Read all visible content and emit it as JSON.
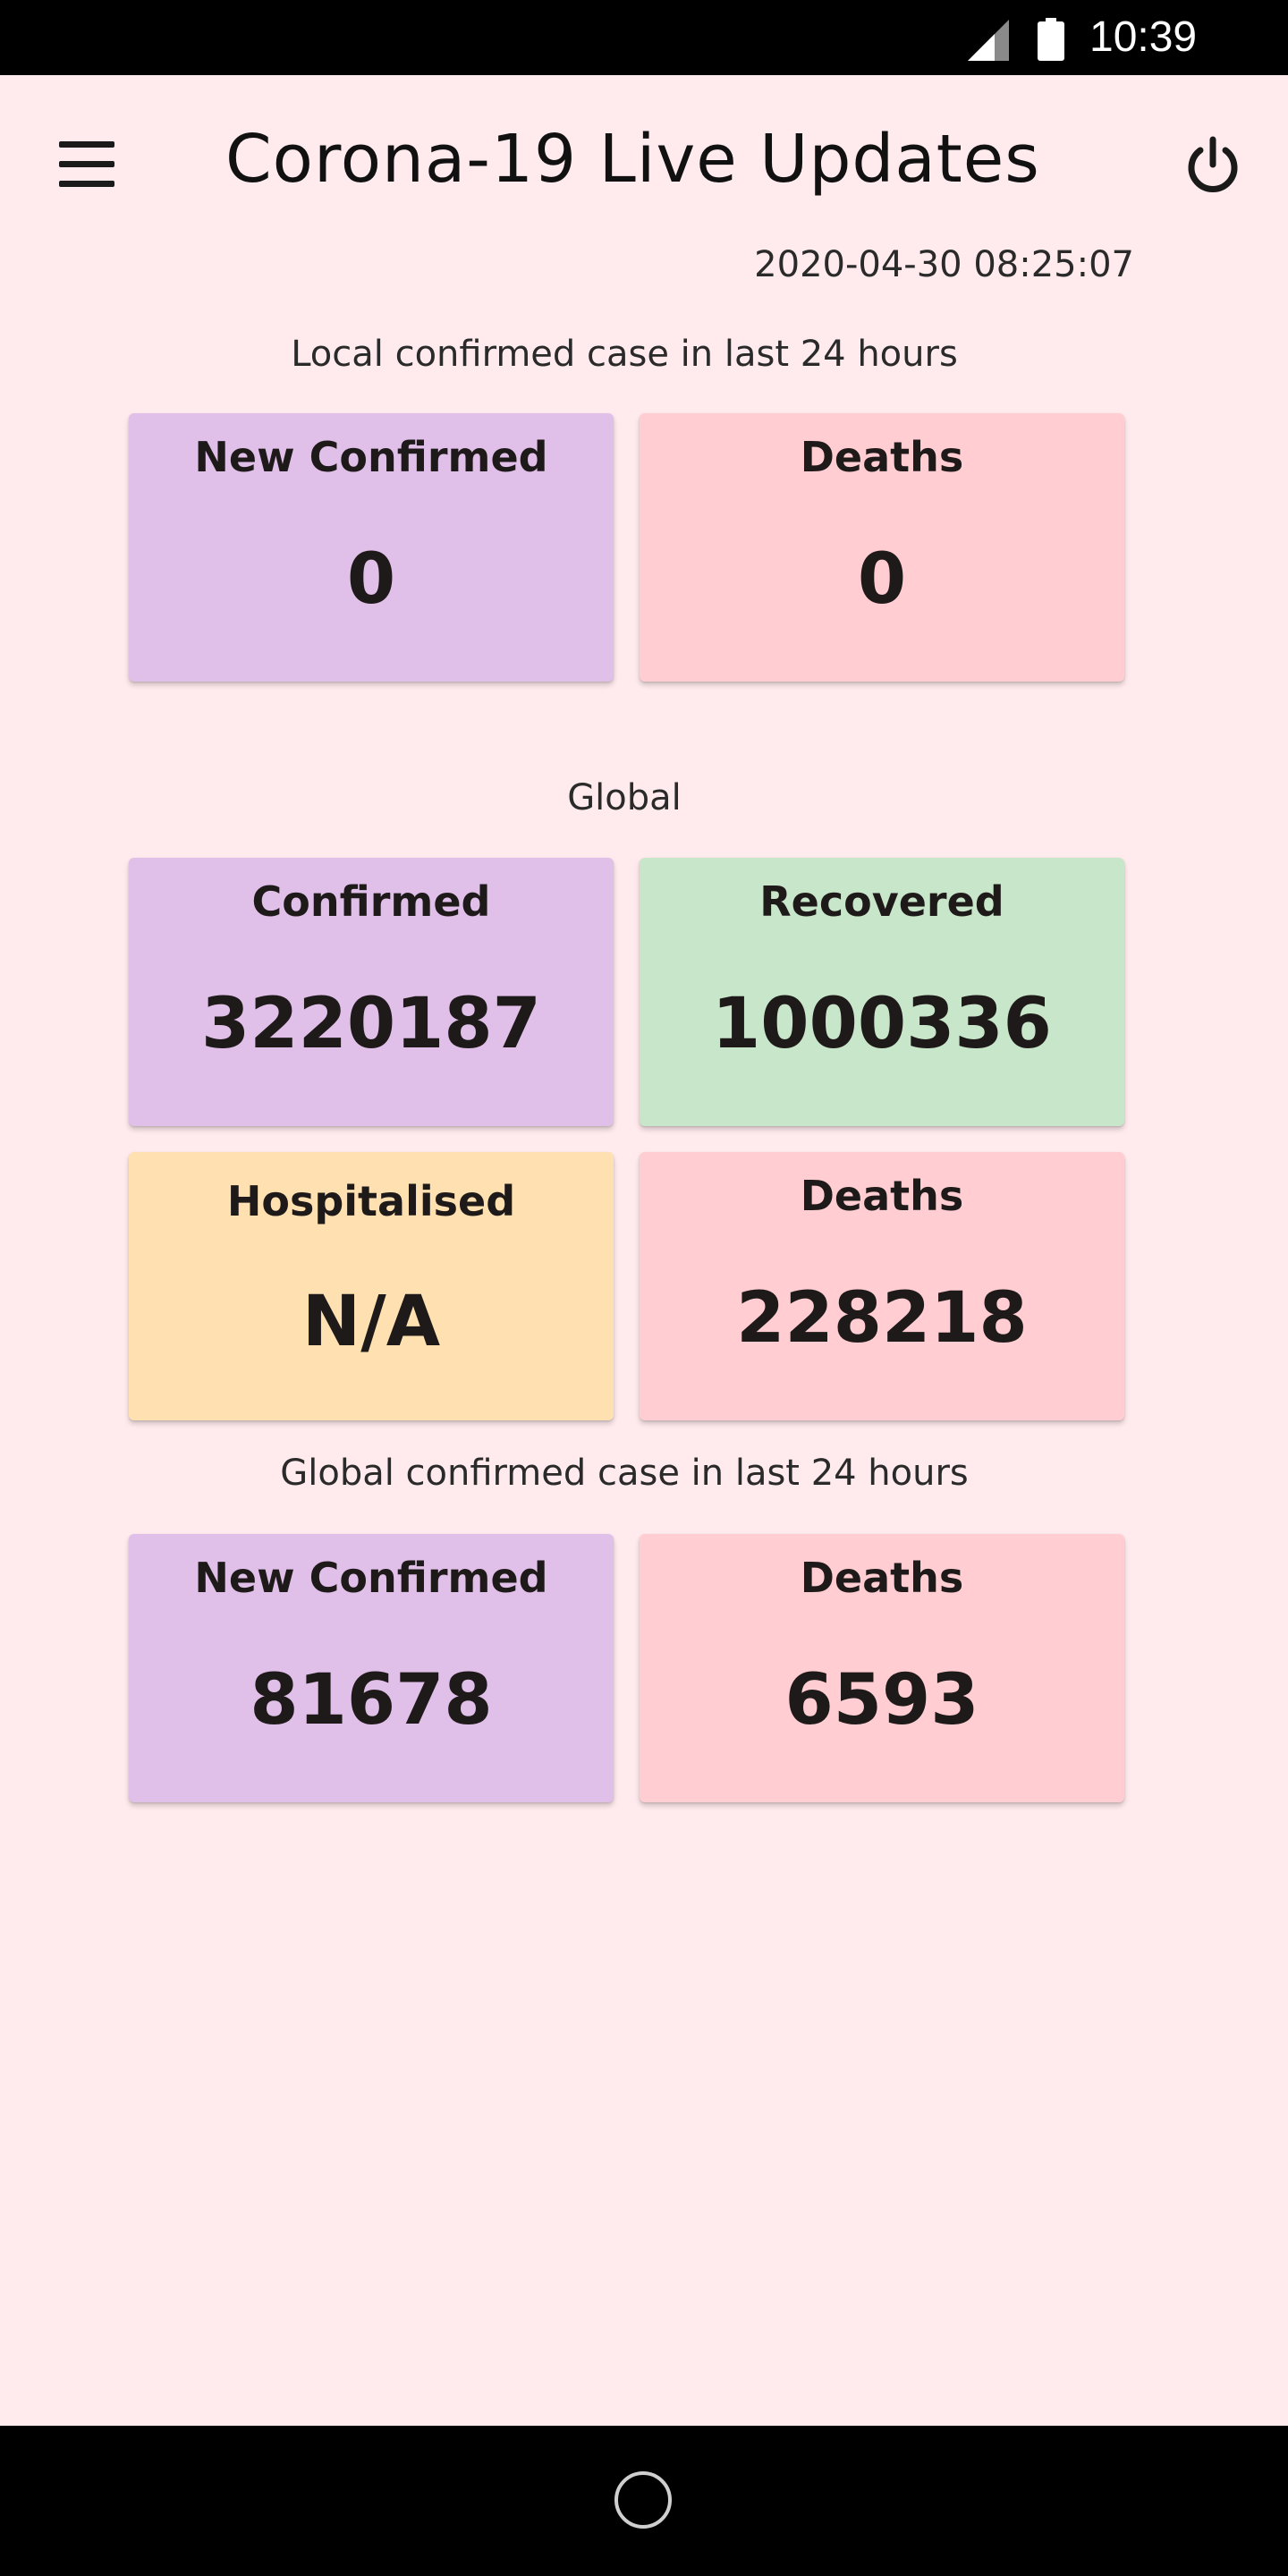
{
  "status_bar": {
    "time": "10:39",
    "icons": [
      "signal-icon",
      "battery-icon"
    ]
  },
  "app_bar": {
    "title": "Corona-19 Live Updates",
    "menu_icon": "hamburger-menu-icon",
    "power_icon": "power-icon"
  },
  "timestamp": "2020-04-30 08:25:07",
  "local_section": {
    "label": "Local confirmed case in last 24 hours",
    "cards": [
      {
        "label": "New Confirmed",
        "value": "0",
        "color": "#e0bfe8"
      },
      {
        "label": "Deaths",
        "value": "0",
        "color": "#ffcdd2"
      }
    ]
  },
  "global_section": {
    "label": "Global",
    "cards": [
      {
        "label": "Confirmed",
        "value": "3220187",
        "color": "#e0bfe8"
      },
      {
        "label": "Recovered",
        "value": "1000336",
        "color": "#c8e6c9"
      },
      {
        "label": "Hospitalised",
        "value": "N/A",
        "color": "#ffe1b1"
      },
      {
        "label": "Deaths",
        "value": "228218",
        "color": "#ffcdd2"
      }
    ]
  },
  "global_24h_section": {
    "label": "Global confirmed case in last 24 hours",
    "cards": [
      {
        "label": "New Confirmed",
        "value": "81678",
        "color": "#e0bfe8"
      },
      {
        "label": "Deaths",
        "value": "6593",
        "color": "#ffcdd2"
      }
    ]
  },
  "nav_bar": {
    "home_icon": "home-circle-icon"
  },
  "colors": {
    "background": "#ffebed",
    "purple": "#e0bfe8",
    "pink": "#ffcdd2",
    "green": "#c8e6c9",
    "orange": "#ffe1b1"
  }
}
